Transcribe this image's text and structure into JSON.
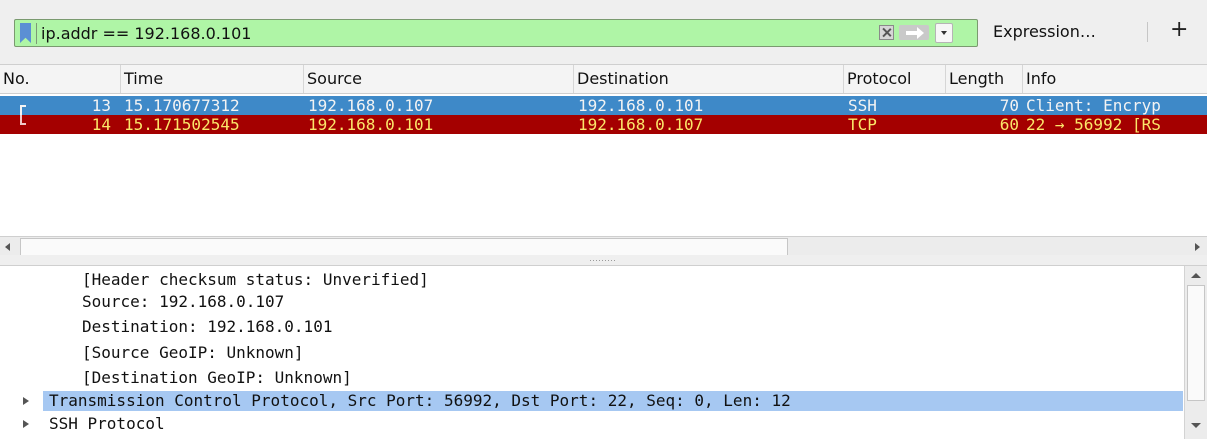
{
  "filter_bar": {
    "value": "ip.addr == 192.168.0.101",
    "bookmark_icon": "bookmark-icon",
    "clear_icon": "clear-x-icon",
    "apply_icon": "arrow-right-icon",
    "dropdown_icon": "chevron-down-icon",
    "expression_label": "Expression…",
    "add_label": "+"
  },
  "packet_list": {
    "columns": [
      "No.",
      "Time",
      "Source",
      "Destination",
      "Protocol",
      "Length",
      "Info"
    ],
    "rows": [
      {
        "no": "13",
        "time": "15.170677312",
        "source": "192.168.0.107",
        "destination": "192.168.0.101",
        "protocol": "SSH",
        "length": "70",
        "info": "Client: Encryp",
        "style": "selected"
      },
      {
        "no": "14",
        "time": "15.171502545",
        "source": "192.168.0.101",
        "destination": "192.168.0.107",
        "protocol": "TCP",
        "length": "60",
        "info": "22 → 56992 [RS",
        "style": "rst"
      }
    ],
    "colors": {
      "selected": "#3e89c8",
      "rst_bg": "#a40000",
      "rst_fg": "#fbe66a"
    }
  },
  "details": {
    "lines": [
      {
        "text": "[Header checksum status: Unverified]",
        "expandable": false
      },
      {
        "text": "Source: 192.168.0.107",
        "expandable": false
      },
      {
        "text": "Destination: 192.168.0.101",
        "expandable": false
      },
      {
        "text": "[Source GeoIP: Unknown]",
        "expandable": false
      },
      {
        "text": "[Destination GeoIP: Unknown]",
        "expandable": false
      },
      {
        "text": "Transmission Control Protocol, Src Port: 56992, Dst Port: 22, Seq: 0, Len: 12",
        "expandable": true,
        "highlighted": true
      },
      {
        "text": "SSH Protocol",
        "expandable": true
      }
    ],
    "highlight_color": "#a6c8f2"
  }
}
